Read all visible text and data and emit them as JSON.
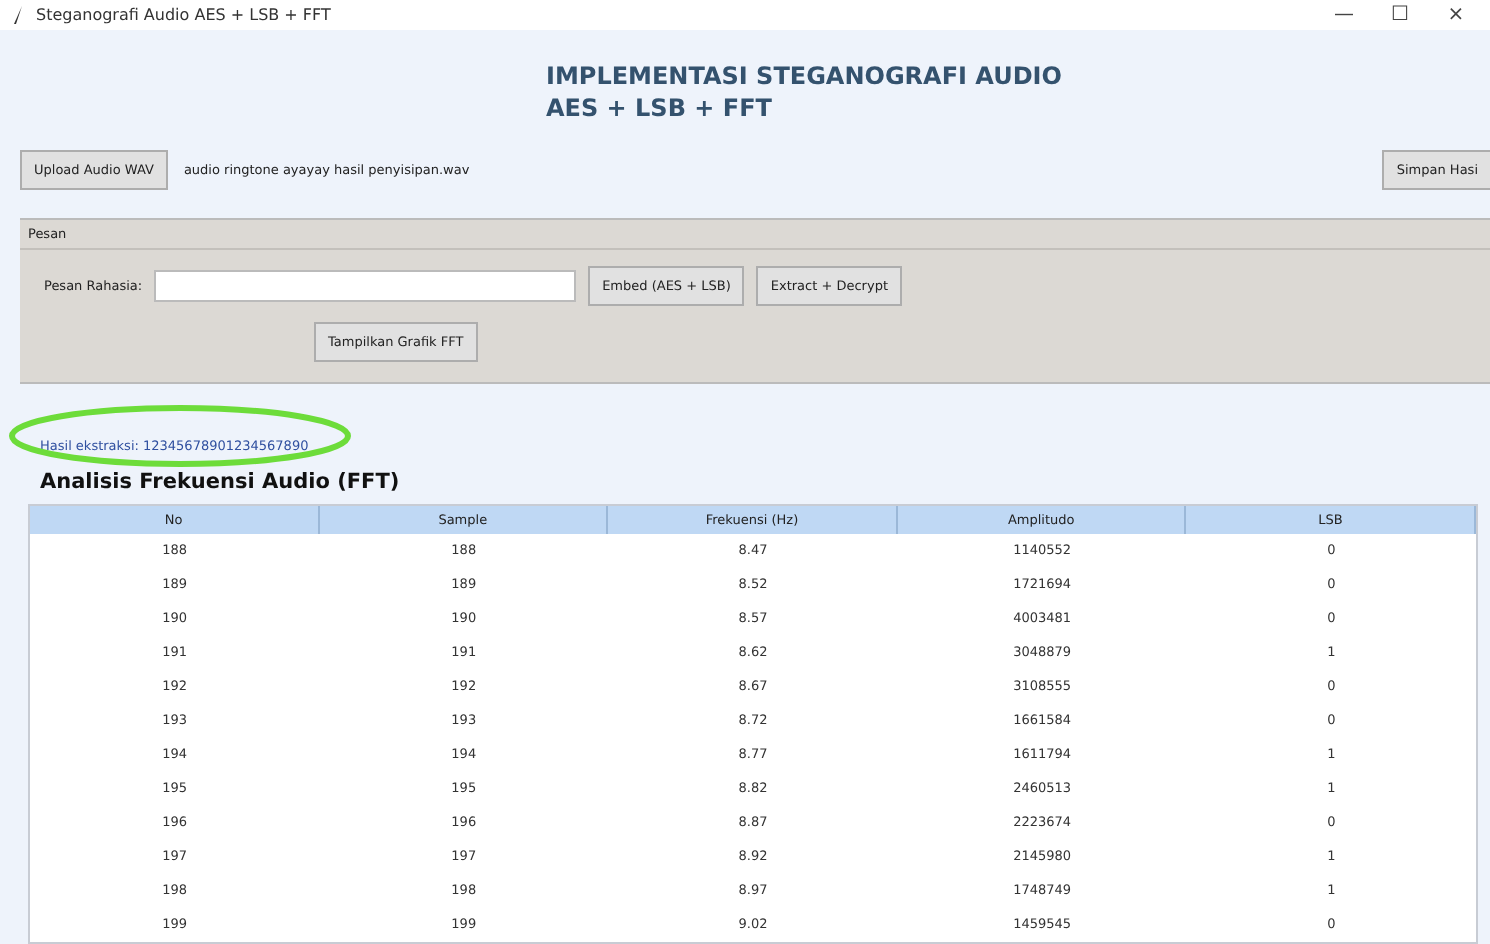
{
  "window": {
    "title": "Steganografi Audio AES + LSB + FFT",
    "controls": [
      "—",
      "☐",
      "×"
    ]
  },
  "header": {
    "lines": [
      "IMPLEMENTASI STEGANOGRAFI AUDIO",
      "AES + LSB + FFT"
    ]
  },
  "file_bar": {
    "upload_button": "Upload Audio WAV",
    "file_name": "audio ringtone ayayay hasil penyisipan.wav",
    "save_button": "Simpan Hasi"
  },
  "message_frame": {
    "title": "Pesan",
    "field_label": "Pesan Rahasia:",
    "buttons": [
      "Embed (AES + LSB)",
      "Extract + Decrypt"
    ],
    "fft_button": "Tampilkan Grafik FFT"
  },
  "result": {
    "text": "Hasil ekstraksi: 12345678901234567890",
    "highlighted": true
  },
  "table": {
    "title": "Analisis Frekuensi Audio (FFT)",
    "columns": [
      "No",
      "Sample",
      "Frekuensi (Hz)",
      "Amplitudo",
      "LSB"
    ],
    "rows": [
      [
        "188",
        "188",
        "8.47",
        "1140552",
        "0"
      ],
      [
        "189",
        "189",
        "8.52",
        "1721694",
        "0"
      ],
      [
        "190",
        "190",
        "8.57",
        "4003481",
        "0"
      ],
      [
        "191",
        "191",
        "8.62",
        "3048879",
        "1"
      ],
      [
        "192",
        "192",
        "8.67",
        "3108555",
        "0"
      ],
      [
        "193",
        "193",
        "8.72",
        "1661584",
        "0"
      ],
      [
        "194",
        "194",
        "8.77",
        "1611794",
        "1"
      ],
      [
        "195",
        "195",
        "8.82",
        "2460513",
        "1"
      ],
      [
        "196",
        "196",
        "8.87",
        "2223674",
        "0"
      ],
      [
        "197",
        "197",
        "8.92",
        "2145980",
        "1"
      ],
      [
        "198",
        "198",
        "8.97",
        "1748749",
        "1"
      ],
      [
        "199",
        "199",
        "9.02",
        "1459545",
        "0"
      ]
    ]
  }
}
